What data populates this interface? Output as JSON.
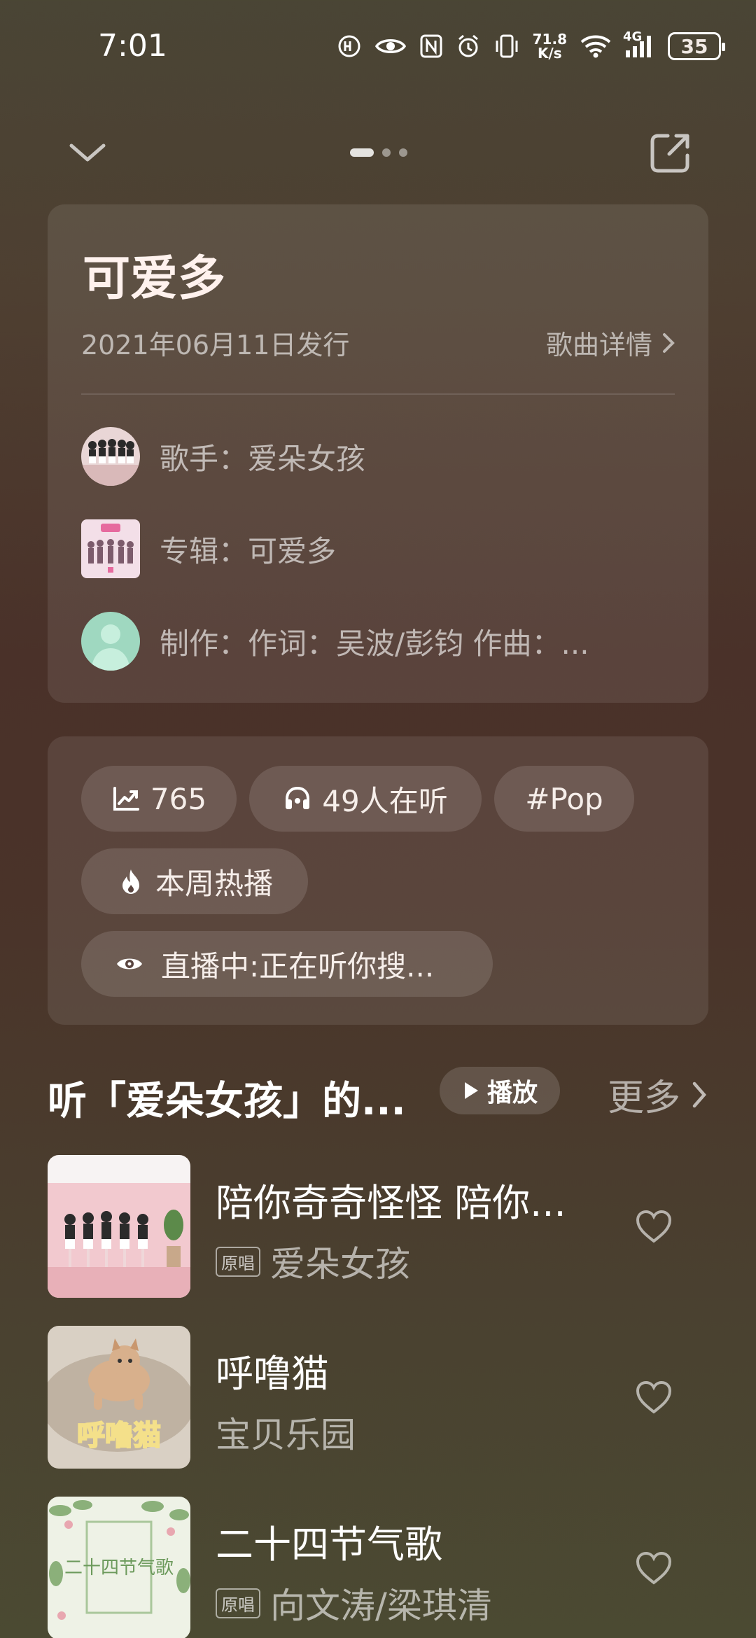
{
  "status_bar": {
    "time": "7:01",
    "net_speed_value": "71.8",
    "net_speed_unit": "K/s",
    "network_type": "4G",
    "battery": "35",
    "icons": [
      "hd-icon",
      "eye-icon",
      "nfc-icon",
      "alarm-icon",
      "vibrate-icon",
      "net-speed",
      "wifi-icon",
      "signal-icon",
      "battery-icon"
    ]
  },
  "top_bar": {
    "icons": [
      "chevron-down-icon",
      "share-icon"
    ],
    "pages": 3,
    "active_page": 1
  },
  "song": {
    "title": "可爱多",
    "release_date": "2021年06月11日发行",
    "detail_link": "歌曲详情",
    "singer": "歌手：爱朵女孩",
    "album": "专辑：可爱多",
    "production": "制作：作词：吴波/彭钧  作曲：..."
  },
  "tags": {
    "trend_count": "765",
    "listeners": "49人在听",
    "genre": "#Pop",
    "weekly_hot": "本周热播",
    "live": "直播中:正在听你搜..."
  },
  "section": {
    "title": "听「爱朵女孩」的...",
    "play_label": "播放",
    "more_label": "更多"
  },
  "songs": [
    {
      "name": "陪你奇奇怪怪 陪你...",
      "badge": "原唱",
      "artist": "爱朵女孩"
    },
    {
      "name": "呼噜猫",
      "badge": "",
      "artist": "宝贝乐园",
      "cover_text": "呼噜猫"
    },
    {
      "name": "二十四节气歌",
      "badge": "原唱",
      "artist": "向文涛/梁琪清",
      "cover_text": "二十四节气歌"
    }
  ],
  "colors": {
    "background_top": "#4a4535",
    "background_mid": "#4a3129",
    "background_bottom": "#4b4a32",
    "text_primary": "#ffffff",
    "text_secondary": "#b7a9a2"
  }
}
